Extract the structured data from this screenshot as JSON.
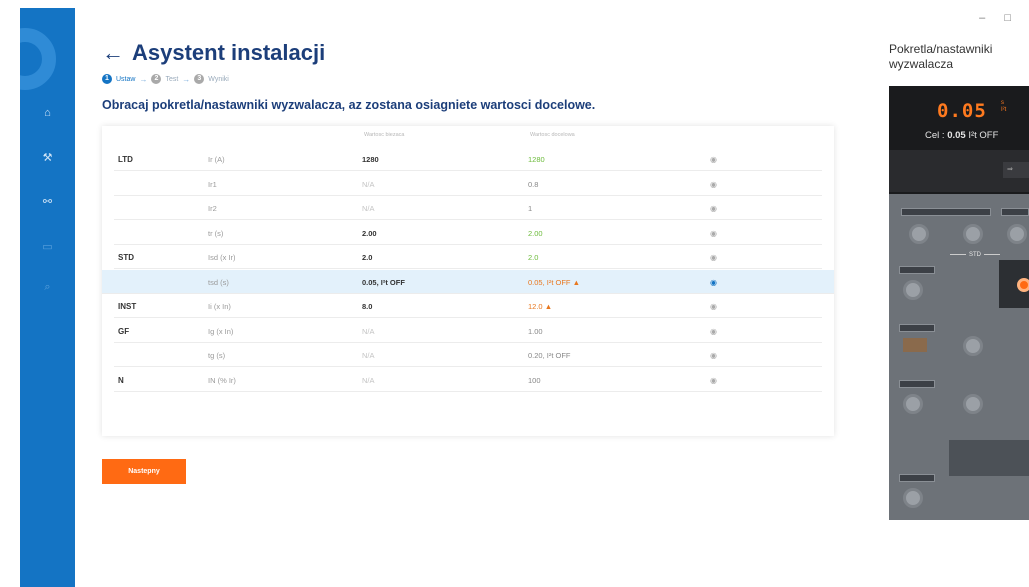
{
  "window": {
    "minimize": "–",
    "restore": "□"
  },
  "sidebar": {
    "items": [
      {
        "icon": "home-icon",
        "glyph": "⌂"
      },
      {
        "icon": "wrench-icon",
        "glyph": "⚒"
      },
      {
        "icon": "link-icon",
        "glyph": "⚯"
      },
      {
        "icon": "tool-icon",
        "glyph": "▭"
      },
      {
        "icon": "search-icon",
        "glyph": "⌕"
      }
    ]
  },
  "header": {
    "back_arrow": "←",
    "title": "Asystent instalacji"
  },
  "steps": [
    {
      "number": "1",
      "label": "Ustaw",
      "state": "active"
    },
    {
      "number": "2",
      "label": "Test",
      "state": "inactive"
    },
    {
      "number": "3",
      "label": "Wyniki",
      "state": "inactive"
    }
  ],
  "step_separator": "→",
  "instruction": "Obracaj pokretla/nastawniki wyzwalacza, az zostana osiagniete wartosci docelowe.",
  "table": {
    "columns": {
      "current": "Wartosc biezaca",
      "target": "Wartosc docelowa"
    },
    "rows": [
      {
        "group": "LTD",
        "param": "Ir (A)",
        "current": "1280",
        "current_na": false,
        "target": "1280",
        "target_state": "ok",
        "warning": false,
        "eye_active": false,
        "highlight": false
      },
      {
        "group": "",
        "param": "Ir1",
        "current": "N/A",
        "current_na": true,
        "target": "0.8",
        "target_state": "muted",
        "warning": false,
        "eye_active": false,
        "highlight": false
      },
      {
        "group": "",
        "param": "Ir2",
        "current": "N/A",
        "current_na": true,
        "target": "1",
        "target_state": "muted",
        "warning": false,
        "eye_active": false,
        "highlight": false
      },
      {
        "group": "",
        "param": "tr (s)",
        "current": "2.00",
        "current_na": false,
        "target": "2.00",
        "target_state": "ok",
        "warning": false,
        "eye_active": false,
        "highlight": false
      },
      {
        "group": "STD",
        "param": "Isd (x Ir)",
        "current": "2.0",
        "current_na": false,
        "target": "2.0",
        "target_state": "ok",
        "warning": false,
        "eye_active": false,
        "highlight": false
      },
      {
        "group": "",
        "param": "tsd (s)",
        "current": "0.05, I²t OFF",
        "current_na": false,
        "target": "0.05, I²t OFF",
        "target_state": "warn",
        "warning": true,
        "eye_active": true,
        "highlight": true
      },
      {
        "group": "INST",
        "param": "Ii (x In)",
        "current": "8.0",
        "current_na": false,
        "target": "12.0",
        "target_state": "warn",
        "warning": true,
        "eye_active": false,
        "highlight": false
      },
      {
        "group": "GF",
        "param": "Ig (x In)",
        "current": "N/A",
        "current_na": true,
        "target": "1.00",
        "target_state": "muted",
        "warning": false,
        "eye_active": false,
        "highlight": false
      },
      {
        "group": "",
        "param": "tg (s)",
        "current": "N/A",
        "current_na": true,
        "target": "0.20, I²t OFF",
        "target_state": "muted",
        "warning": false,
        "eye_active": false,
        "highlight": false
      },
      {
        "group": "N",
        "param": "IN (% Ir)",
        "current": "N/A",
        "current_na": true,
        "target": "100",
        "target_state": "muted",
        "warning": false,
        "eye_active": false,
        "highlight": false
      }
    ]
  },
  "next_button": "Nastepny",
  "right_panel": {
    "title": "Pokretla/nastawniki wyzwalacza",
    "readout_value": "0.05",
    "readout_unit_top": "s",
    "readout_unit_bottom": "I²t",
    "target_prefix": "Cel : ",
    "target_value": "0.05",
    "target_suffix": " I²t OFF",
    "std_label": "STD"
  },
  "colors": {
    "sidebar": "#1474c4",
    "title": "#1c3e7a",
    "accent_orange": "#ff6a13",
    "ok_green": "#6dbb3c",
    "warn_orange": "#e8771e",
    "highlight_row": "#e3f1fb"
  }
}
